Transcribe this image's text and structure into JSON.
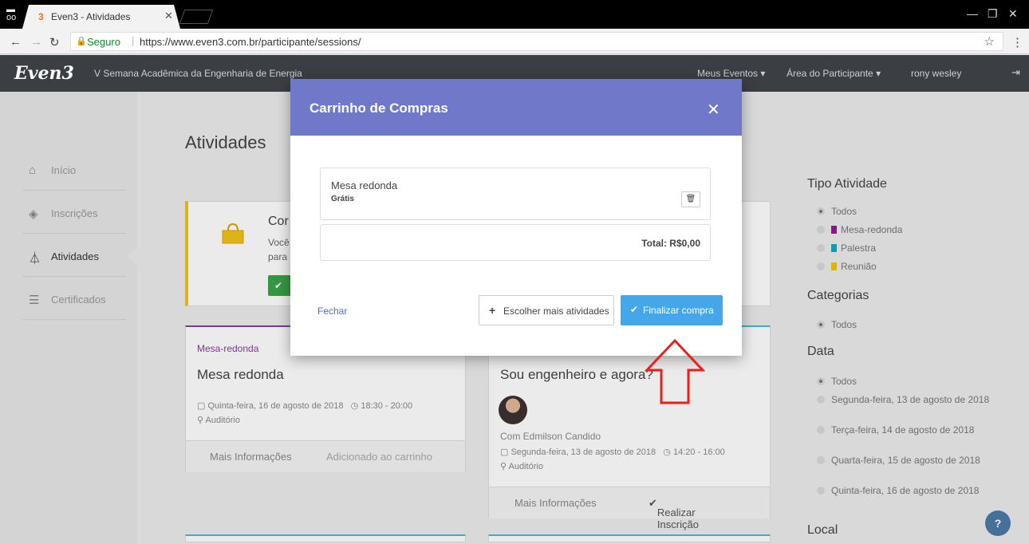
{
  "browser": {
    "tab_number": "3",
    "tab_title": "Even3 - Atividades",
    "secure_label": "Seguro",
    "url": "https://www.even3.com.br/participante/sessions/"
  },
  "header": {
    "logo": "Even3",
    "event_name": "V Semana Acadêmica da Engenharia de Energia",
    "nav": [
      "Meus Eventos ▾",
      "Área do Participante ▾",
      "rony wesley"
    ]
  },
  "sidebar": {
    "items": [
      {
        "label": "Início",
        "icon": "home-icon"
      },
      {
        "label": "Inscrições",
        "icon": "tag-icon"
      },
      {
        "label": "Atividades",
        "icon": "flask-icon"
      },
      {
        "label": "Certificados",
        "icon": "certificate-icon"
      }
    ]
  },
  "main": {
    "title": "Atividades",
    "alert": {
      "title_partial": "Cor",
      "line1_partial": "Você",
      "line2_partial": "para"
    },
    "cards": [
      {
        "type": "Mesa-redonda",
        "title": "Mesa redonda",
        "date": "Quinta-feira, 16 de agosto de 2018",
        "time": "18:30 - 20:00",
        "place": "Auditório",
        "footer_left": "Mais Informações",
        "footer_right": "Adicionado ao carrinho"
      },
      {
        "type": "",
        "title": "Sou engenheiro e agora?",
        "speaker": "Com Edmilson Candido",
        "date": "Segunda-feira, 13 de agosto de 2018",
        "time": "14:20 - 16:00",
        "place": "Auditório",
        "footer_left": "Mais Informações",
        "footer_right": "Realizar Inscrição"
      }
    ]
  },
  "filters": {
    "tipo_title": "Tipo Atividade",
    "tipo_options": [
      {
        "label": "Todos",
        "color": "",
        "selected": true
      },
      {
        "label": "Mesa-redonda",
        "color": "#8b1e8b",
        "selected": false
      },
      {
        "label": "Palestra",
        "color": "#1fa3b8",
        "selected": false
      },
      {
        "label": "Reunião",
        "color": "#f0c419",
        "selected": false
      }
    ],
    "categorias_title": "Categorias",
    "categorias_options": [
      {
        "label": "Todos",
        "selected": true
      }
    ],
    "data_title": "Data",
    "data_options": [
      {
        "label": "Todos",
        "selected": true
      },
      {
        "label": "Segunda-feira, 13 de agosto de 2018",
        "selected": false
      },
      {
        "label": "Terça-feira, 14 de agosto de 2018",
        "selected": false
      },
      {
        "label": "Quarta-feira, 15 de agosto de 2018",
        "selected": false
      },
      {
        "label": "Quinta-feira, 16 de agosto de 2018",
        "selected": false
      }
    ],
    "local_title": "Local"
  },
  "modal": {
    "title": "Carrinho de Compras",
    "item_name": "Mesa redonda",
    "item_price": "Grátis",
    "total": "Total: R$0,00",
    "close_link": "Fechar",
    "more_button": "Escolher mais atividades",
    "finalize_button": "Finalizar compra"
  },
  "colors": {
    "modal_header": "#6f78c9",
    "finalize_button": "#45a6ea",
    "annotation_arrow": "#e8201c"
  }
}
